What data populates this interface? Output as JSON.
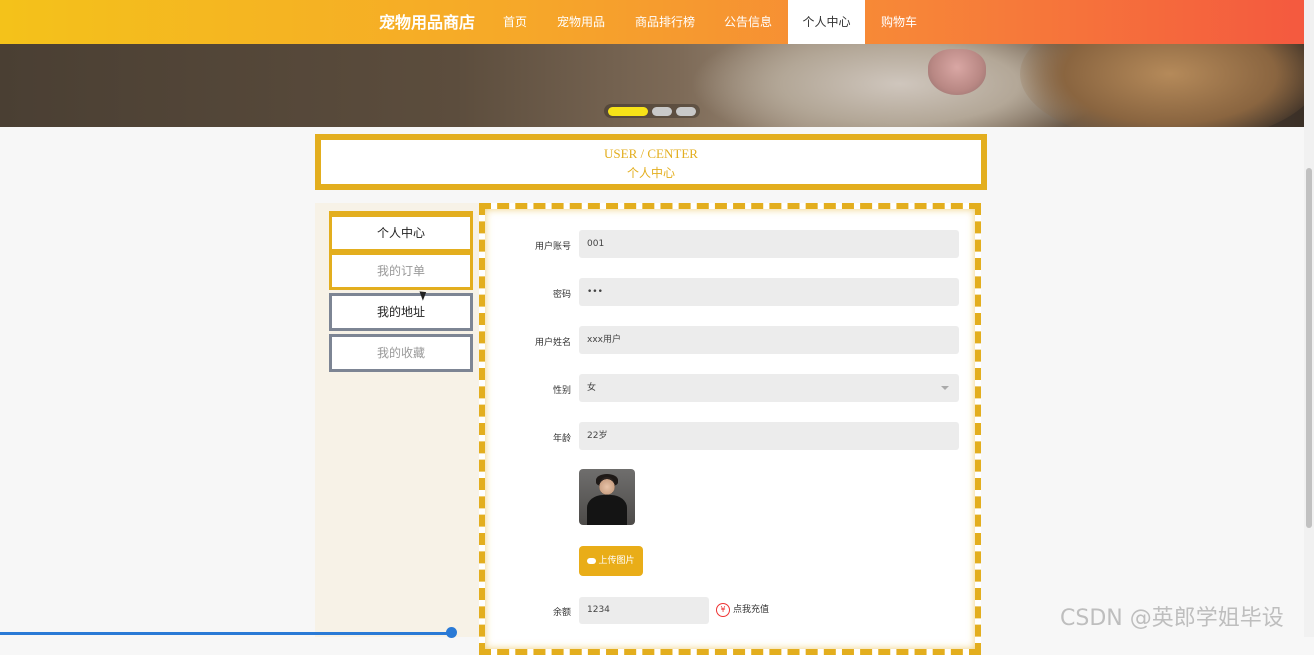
{
  "brand": "宠物用品商店",
  "nav": {
    "items": [
      "首页",
      "宠物用品",
      "商品排行榜",
      "公告信息",
      "个人中心",
      "购物车"
    ],
    "active": "个人中心"
  },
  "carousel": {
    "slides": 3,
    "active_index": 0
  },
  "header": {
    "title_en": "USER / CENTER",
    "title_cn": "个人中心"
  },
  "sidebar": {
    "items": [
      "个人中心",
      "我的订单",
      "我的地址",
      "我的收藏"
    ]
  },
  "form": {
    "account_label": "用户账号",
    "account_value": "001",
    "password_label": "密码",
    "password_value": "•••",
    "name_label": "用户姓名",
    "name_value": "xxx用户",
    "gender_label": "性别",
    "gender_value": "女",
    "age_label": "年龄",
    "age_value": "22岁",
    "upload_label": "上传图片",
    "balance_label": "余额",
    "balance_value": "1234",
    "recharge_label": "点我充值"
  },
  "watermark": "CSDN @英郎学姐毕设",
  "colors": {
    "accent": "#e3ae1e",
    "nav_gradient_start": "#f4c21a",
    "nav_gradient_end": "#f4593f"
  },
  "icons": {
    "upload": "cloud-upload-icon",
    "recharge": "yen-circle-icon",
    "select": "chevron-down-icon"
  }
}
